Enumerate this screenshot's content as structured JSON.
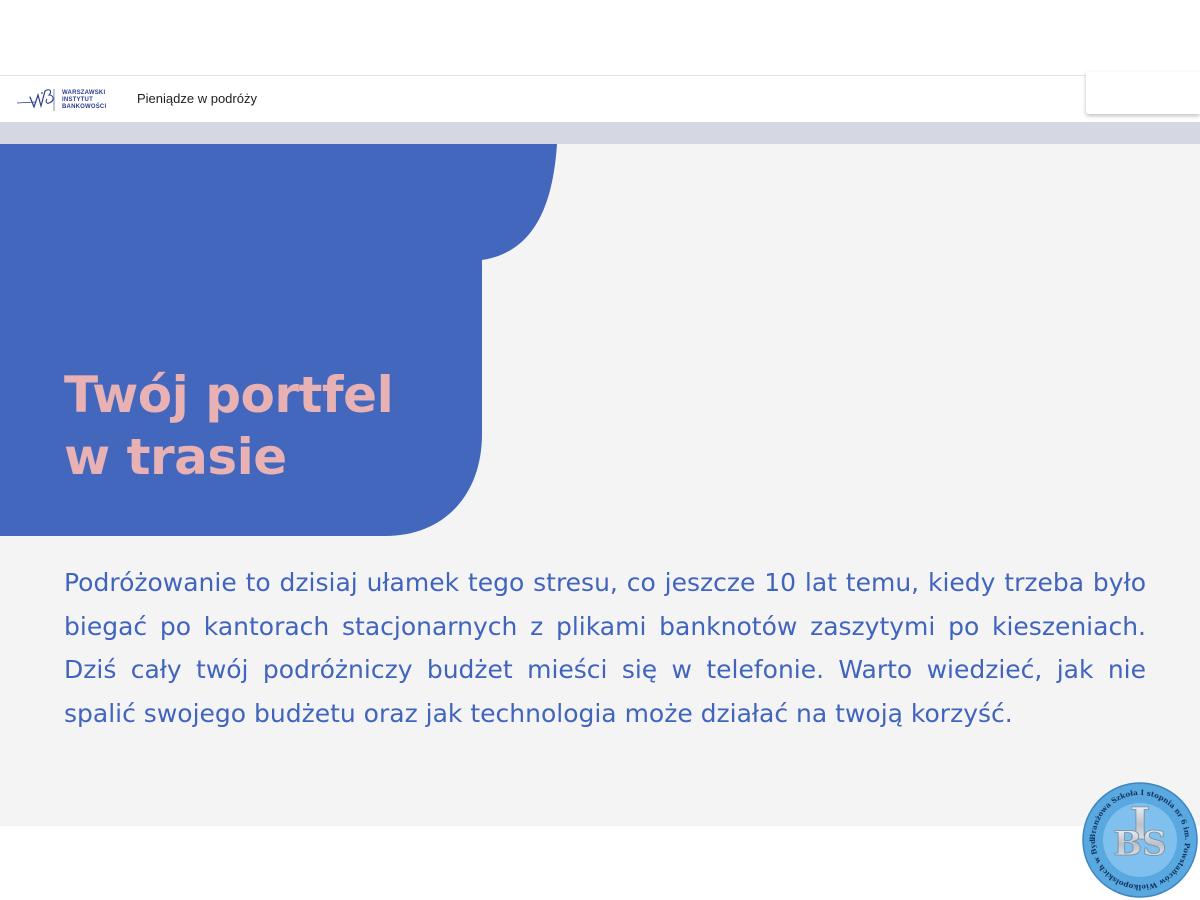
{
  "header": {
    "logo_lines": [
      "WARSZAWSKI",
      "INSTYTUT",
      "BANKOWOŚCI"
    ],
    "title": "Pieniądze w podróży"
  },
  "slide": {
    "title_line1": "Twój portfel",
    "title_line2": "w trasie",
    "body": "Podróżowanie to dzisiaj ułamek tego stresu, co jeszcze 10 lat temu, kiedy trzeba było biegać po kantorach stacjonarnych z plikami banknotów zaszytymi po kieszeniach. Dziś cały twój podróżniczy budżet mieści się w telefonie. Warto wiedzieć, jak nie spalić swojego budżetu oraz jak technologia może działać na twoją korzyść."
  },
  "badge": {
    "ring_text": "Branżowa Szkoła I stopnia nr 6 im. Powstańców Wielkopolskich w Bydgoszczy",
    "initials": "BS",
    "numeral": "I"
  },
  "colors": {
    "blob_blue": "#4267bd",
    "title_pink": "#e8b1b4",
    "body_blue": "#4164bd",
    "slide_bg": "#f4f4f5",
    "strip_grey": "#d5d8e2",
    "badge_blue": "#5aa8e0"
  },
  "icons": {
    "logo": "wib-signature-logo",
    "badge": "school-emblem"
  }
}
